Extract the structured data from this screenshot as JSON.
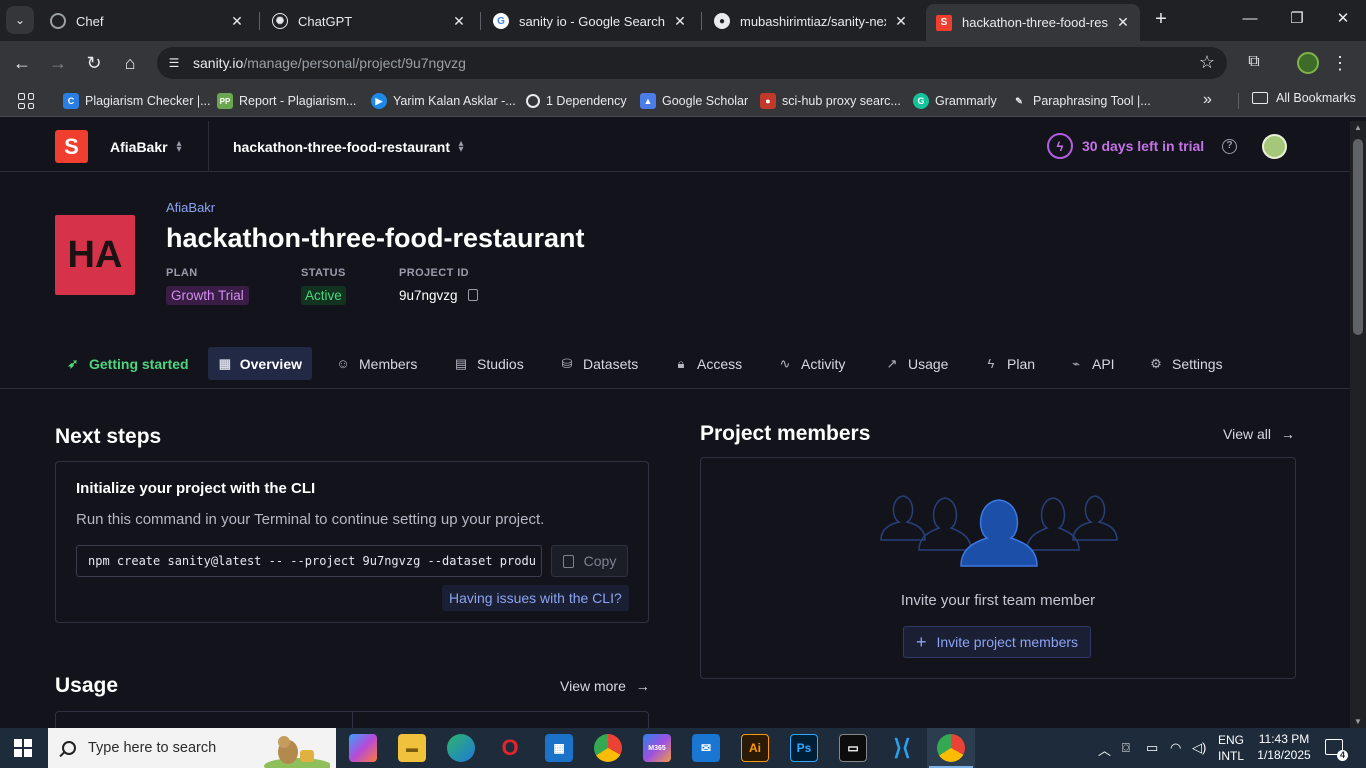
{
  "browser": {
    "tabs": [
      {
        "title": "Chef",
        "active": false
      },
      {
        "title": "ChatGPT",
        "active": false
      },
      {
        "title": "sanity io - Google Search",
        "active": false
      },
      {
        "title": "mubashirimtiaz/sanity-nextjs",
        "active": false
      },
      {
        "title": "hackathon-three-food-restaurant",
        "active": true
      }
    ],
    "url_host": "sanity.io",
    "url_path": "/manage/personal/project/9u7ngvzg",
    "bookmarks": [
      "Plagiarism Checker |...",
      "Report - Plagiarism...",
      "Yarim Kalan Asklar -...",
      "1 Dependency",
      "Google Scholar",
      "sci-hub proxy searc...",
      "Grammarly",
      "Paraphrasing Tool |..."
    ],
    "all_bookmarks": "All Bookmarks"
  },
  "topbar": {
    "logo_letter": "S",
    "org_name": "AfiaBakr",
    "project_selector": "hackathon-three-food-restaurant",
    "trial_text": "30 days left in trial",
    "help_label": "?"
  },
  "project": {
    "badge": "HA",
    "breadcrumb": "AfiaBakr",
    "title": "hackathon-three-food-restaurant",
    "plan_label": "PLAN",
    "plan_value": "Growth Trial",
    "status_label": "STATUS",
    "status_value": "Active",
    "id_label": "PROJECT ID",
    "id_value": "9u7ngvzg"
  },
  "nav_tabs": [
    {
      "label": "Getting started",
      "icon": "rocket-icon"
    },
    {
      "label": "Overview",
      "icon": "overview-icon",
      "selected": true
    },
    {
      "label": "Members",
      "icon": "members-icon"
    },
    {
      "label": "Studios",
      "icon": "studios-icon"
    },
    {
      "label": "Datasets",
      "icon": "database-icon"
    },
    {
      "label": "Access",
      "icon": "lock-icon"
    },
    {
      "label": "Activity",
      "icon": "activity-icon"
    },
    {
      "label": "Usage",
      "icon": "chart-icon"
    },
    {
      "label": "Plan",
      "icon": "bolt-icon"
    },
    {
      "label": "API",
      "icon": "plug-icon"
    },
    {
      "label": "Settings",
      "icon": "gear-icon"
    }
  ],
  "next_steps": {
    "heading": "Next steps",
    "card_title": "Initialize your project with the CLI",
    "card_desc": "Run this command in your Terminal to continue setting up your project.",
    "command": "npm create sanity@latest -- --project 9u7ngvzg --dataset produ",
    "copy_label": "Copy",
    "help_link": "Having issues with the CLI?"
  },
  "members": {
    "heading": "Project members",
    "view_all": "View all",
    "invite_text": "Invite your first team member",
    "invite_button": "Invite project members"
  },
  "usage": {
    "heading": "Usage",
    "view_more": "View more"
  },
  "taskbar": {
    "search_placeholder": "Type here to search",
    "lang_line1": "ENG",
    "lang_line2": "INTL",
    "time": "11:43 PM",
    "date": "1/18/2025",
    "notification_count": "4"
  },
  "colors": {
    "page_bg": "#13141b",
    "accent_blue": "#8aa4f2",
    "trial_purple": "#c472e8",
    "active_green": "#4cd47e",
    "badge_red": "#d6334b",
    "sanity_red": "#f03e2f"
  }
}
